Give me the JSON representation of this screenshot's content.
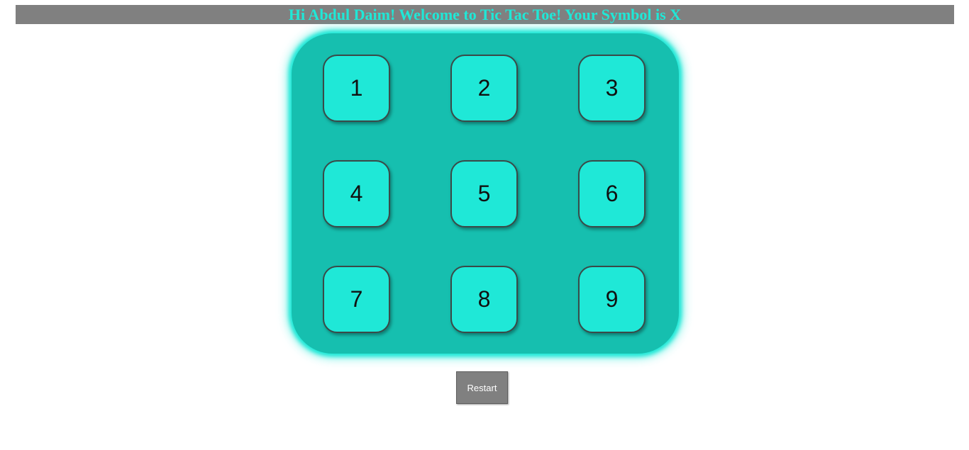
{
  "header": {
    "welcome_text": "Hi Abdul Daim! Welcome to Tic Tac Toe! Your Symbol is X"
  },
  "board": {
    "cells": [
      "1",
      "2",
      "3",
      "4",
      "5",
      "6",
      "7",
      "8",
      "9"
    ]
  },
  "controls": {
    "restart_label": "Restart"
  },
  "colors": {
    "header_bg": "#808080",
    "header_text": "#1fe8d7",
    "board_bg": "#16bfaf",
    "cell_bg": "#1fe8d7",
    "button_bg": "#808080"
  }
}
